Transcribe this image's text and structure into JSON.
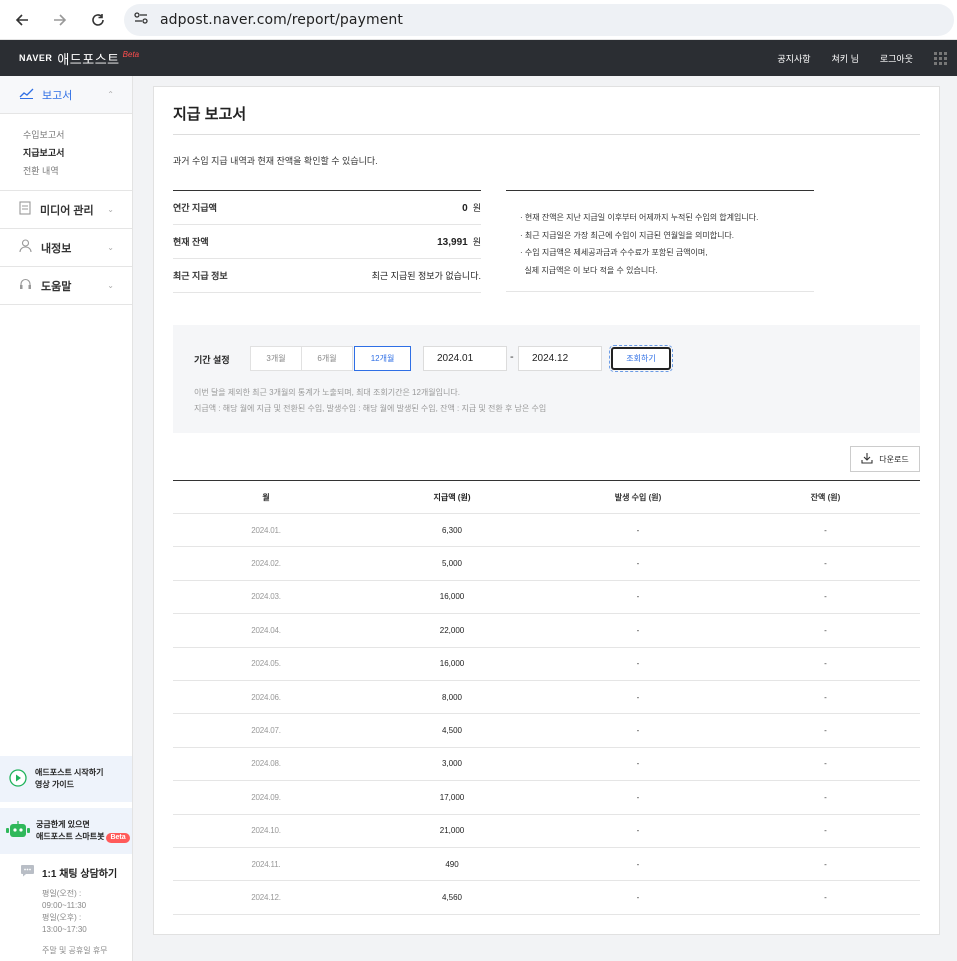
{
  "browser": {
    "url": "adpost.naver.com/report/payment"
  },
  "header": {
    "logo_naver": "NAVER",
    "logo_service": "애드포스트",
    "logo_beta": "Beta",
    "links": [
      "공지사항",
      "쳐키 님",
      "로그아웃"
    ]
  },
  "sidebar": {
    "report_label": "보고서",
    "report_sub": [
      "수입보고서",
      "지급보고서",
      "전환 내역"
    ],
    "media_label": "미디어 관리",
    "myinfo_label": "내정보",
    "help_label": "도움말",
    "guide_line1": "애드포스트 시작하기",
    "guide_line2": "영상 가이드",
    "bot_line1": "궁금한게 있으면",
    "bot_line2": "애드포스트 스마트봇",
    "bot_beta": "Beta",
    "chat_title": "1:1 채팅 상담하기",
    "chat_hours": [
      "평일(오전) :",
      "09:00~11:30",
      "평일(오후) :",
      "13:00~17:30"
    ],
    "chat_holiday": "주말 및 공휴일 휴무"
  },
  "main": {
    "title": "지급 보고서",
    "description": "과거 수입 지급 내역과 현재 잔액을 확인할 수 있습니다.",
    "summary": {
      "annual_label": "연간 지급액",
      "annual_value": "0",
      "balance_label": "현재 잔액",
      "balance_value": "13,991",
      "unit": "원",
      "recent_label": "최근 지급 정보",
      "recent_value": "최근 지급된 정보가 없습니다."
    },
    "notes": [
      "· 현재 잔액은 지난 지급일 이후부터 어제까지 누적된 수입의 합계입니다.",
      "· 최근 지급일은 가장 최근에 수입이 지급된 연월일을 의미합니다.",
      "· 수입 지급액은 제세공과금과 수수료가 포함된 금액이며,",
      "  실제 지급액은 이 보다 적을 수 있습니다."
    ],
    "filter": {
      "label": "기간 설정",
      "periods": [
        "3개월",
        "6개월",
        "12개월"
      ],
      "start": "2024.01",
      "end": "2024.12",
      "separator": "-",
      "search_label": "조회하기",
      "note1": "이번 달을 제외한 최근 3개월의 통계가 노출되며, 최대 조회기간은 12개월입니다.",
      "note2": "지급액 : 해당 월에 지급 및 전환된 수입, 발생수입 : 해당 월에 발생된 수입, 잔액 : 지급 및 전환 후 남은 수입"
    },
    "download_label": "다운로드",
    "table": {
      "headers": [
        "월",
        "지급액 (원)",
        "발생 수입 (원)",
        "잔액 (원)"
      ],
      "rows": [
        [
          "2024.01.",
          "6,300",
          "-",
          "-"
        ],
        [
          "2024.02.",
          "5,000",
          "-",
          "-"
        ],
        [
          "2024.03.",
          "16,000",
          "-",
          "-"
        ],
        [
          "2024.04.",
          "22,000",
          "-",
          "-"
        ],
        [
          "2024.05.",
          "16,000",
          "-",
          "-"
        ],
        [
          "2024.06.",
          "8,000",
          "-",
          "-"
        ],
        [
          "2024.07.",
          "4,500",
          "-",
          "-"
        ],
        [
          "2024.08.",
          "3,000",
          "-",
          "-"
        ],
        [
          "2024.09.",
          "17,000",
          "-",
          "-"
        ],
        [
          "2024.10.",
          "21,000",
          "-",
          "-"
        ],
        [
          "2024.11.",
          "490",
          "-",
          "-"
        ],
        [
          "2024.12.",
          "4,560",
          "-",
          "-"
        ]
      ]
    }
  }
}
